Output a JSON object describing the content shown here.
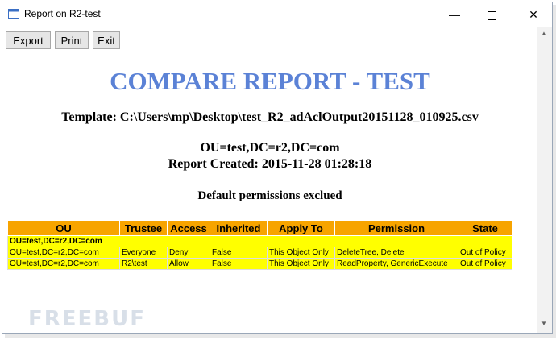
{
  "window": {
    "title": "Report on R2-test"
  },
  "toolbar": {
    "export_label": "Export",
    "print_label": "Print",
    "exit_label": "Exit"
  },
  "report": {
    "title": "COMPARE REPORT - TEST",
    "template_line": "Template: C:\\Users\\mp\\Desktop\\test_R2_adAclOutput20151128_010925.csv",
    "ou_line": "OU=test,DC=r2,DC=com",
    "created_line": "Report Created: 2015-11-28 01:28:18",
    "note_line": "Default permissions exclued"
  },
  "table": {
    "headers": [
      "OU",
      "Trustee",
      "Access",
      "Inherited",
      "Apply To",
      "Permission",
      "State"
    ],
    "group": "OU=test,DC=r2,DC=com",
    "rows": [
      [
        "OU=test,DC=r2,DC=com",
        "Everyone",
        "Deny",
        "False",
        "This Object Only",
        "DeleteTree, Delete",
        "Out of Policy"
      ],
      [
        "OU=test,DC=r2,DC=com",
        "R2\\test",
        "Allow",
        "False",
        "This Object Only",
        "ReadProperty, GenericExecute",
        "Out of Policy"
      ]
    ]
  },
  "colors": {
    "title_blue": "#5b82d6",
    "header_orange": "#f7a400",
    "row_yellow": "#ffff00"
  },
  "icons": {
    "app": "report-window-icon",
    "min": "minimize-icon",
    "max": "maximize-icon",
    "close": "close-icon"
  },
  "watermark": "FREEBUF"
}
